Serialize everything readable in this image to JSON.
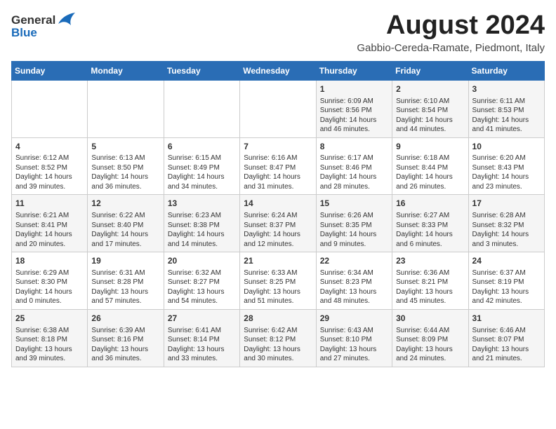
{
  "logo": {
    "general": "General",
    "blue": "Blue"
  },
  "title": {
    "month_year": "August 2024",
    "location": "Gabbio-Cereda-Ramate, Piedmont, Italy"
  },
  "weekdays": [
    "Sunday",
    "Monday",
    "Tuesday",
    "Wednesday",
    "Thursday",
    "Friday",
    "Saturday"
  ],
  "weeks": [
    [
      {
        "day": "",
        "content": ""
      },
      {
        "day": "",
        "content": ""
      },
      {
        "day": "",
        "content": ""
      },
      {
        "day": "",
        "content": ""
      },
      {
        "day": "1",
        "content": "Sunrise: 6:09 AM\nSunset: 8:56 PM\nDaylight: 14 hours and 46 minutes."
      },
      {
        "day": "2",
        "content": "Sunrise: 6:10 AM\nSunset: 8:54 PM\nDaylight: 14 hours and 44 minutes."
      },
      {
        "day": "3",
        "content": "Sunrise: 6:11 AM\nSunset: 8:53 PM\nDaylight: 14 hours and 41 minutes."
      }
    ],
    [
      {
        "day": "4",
        "content": "Sunrise: 6:12 AM\nSunset: 8:52 PM\nDaylight: 14 hours and 39 minutes."
      },
      {
        "day": "5",
        "content": "Sunrise: 6:13 AM\nSunset: 8:50 PM\nDaylight: 14 hours and 36 minutes."
      },
      {
        "day": "6",
        "content": "Sunrise: 6:15 AM\nSunset: 8:49 PM\nDaylight: 14 hours and 34 minutes."
      },
      {
        "day": "7",
        "content": "Sunrise: 6:16 AM\nSunset: 8:47 PM\nDaylight: 14 hours and 31 minutes."
      },
      {
        "day": "8",
        "content": "Sunrise: 6:17 AM\nSunset: 8:46 PM\nDaylight: 14 hours and 28 minutes."
      },
      {
        "day": "9",
        "content": "Sunrise: 6:18 AM\nSunset: 8:44 PM\nDaylight: 14 hours and 26 minutes."
      },
      {
        "day": "10",
        "content": "Sunrise: 6:20 AM\nSunset: 8:43 PM\nDaylight: 14 hours and 23 minutes."
      }
    ],
    [
      {
        "day": "11",
        "content": "Sunrise: 6:21 AM\nSunset: 8:41 PM\nDaylight: 14 hours and 20 minutes."
      },
      {
        "day": "12",
        "content": "Sunrise: 6:22 AM\nSunset: 8:40 PM\nDaylight: 14 hours and 17 minutes."
      },
      {
        "day": "13",
        "content": "Sunrise: 6:23 AM\nSunset: 8:38 PM\nDaylight: 14 hours and 14 minutes."
      },
      {
        "day": "14",
        "content": "Sunrise: 6:24 AM\nSunset: 8:37 PM\nDaylight: 14 hours and 12 minutes."
      },
      {
        "day": "15",
        "content": "Sunrise: 6:26 AM\nSunset: 8:35 PM\nDaylight: 14 hours and 9 minutes."
      },
      {
        "day": "16",
        "content": "Sunrise: 6:27 AM\nSunset: 8:33 PM\nDaylight: 14 hours and 6 minutes."
      },
      {
        "day": "17",
        "content": "Sunrise: 6:28 AM\nSunset: 8:32 PM\nDaylight: 14 hours and 3 minutes."
      }
    ],
    [
      {
        "day": "18",
        "content": "Sunrise: 6:29 AM\nSunset: 8:30 PM\nDaylight: 14 hours and 0 minutes."
      },
      {
        "day": "19",
        "content": "Sunrise: 6:31 AM\nSunset: 8:28 PM\nDaylight: 13 hours and 57 minutes."
      },
      {
        "day": "20",
        "content": "Sunrise: 6:32 AM\nSunset: 8:27 PM\nDaylight: 13 hours and 54 minutes."
      },
      {
        "day": "21",
        "content": "Sunrise: 6:33 AM\nSunset: 8:25 PM\nDaylight: 13 hours and 51 minutes."
      },
      {
        "day": "22",
        "content": "Sunrise: 6:34 AM\nSunset: 8:23 PM\nDaylight: 13 hours and 48 minutes."
      },
      {
        "day": "23",
        "content": "Sunrise: 6:36 AM\nSunset: 8:21 PM\nDaylight: 13 hours and 45 minutes."
      },
      {
        "day": "24",
        "content": "Sunrise: 6:37 AM\nSunset: 8:19 PM\nDaylight: 13 hours and 42 minutes."
      }
    ],
    [
      {
        "day": "25",
        "content": "Sunrise: 6:38 AM\nSunset: 8:18 PM\nDaylight: 13 hours and 39 minutes."
      },
      {
        "day": "26",
        "content": "Sunrise: 6:39 AM\nSunset: 8:16 PM\nDaylight: 13 hours and 36 minutes."
      },
      {
        "day": "27",
        "content": "Sunrise: 6:41 AM\nSunset: 8:14 PM\nDaylight: 13 hours and 33 minutes."
      },
      {
        "day": "28",
        "content": "Sunrise: 6:42 AM\nSunset: 8:12 PM\nDaylight: 13 hours and 30 minutes."
      },
      {
        "day": "29",
        "content": "Sunrise: 6:43 AM\nSunset: 8:10 PM\nDaylight: 13 hours and 27 minutes."
      },
      {
        "day": "30",
        "content": "Sunrise: 6:44 AM\nSunset: 8:09 PM\nDaylight: 13 hours and 24 minutes."
      },
      {
        "day": "31",
        "content": "Sunrise: 6:46 AM\nSunset: 8:07 PM\nDaylight: 13 hours and 21 minutes."
      }
    ]
  ]
}
